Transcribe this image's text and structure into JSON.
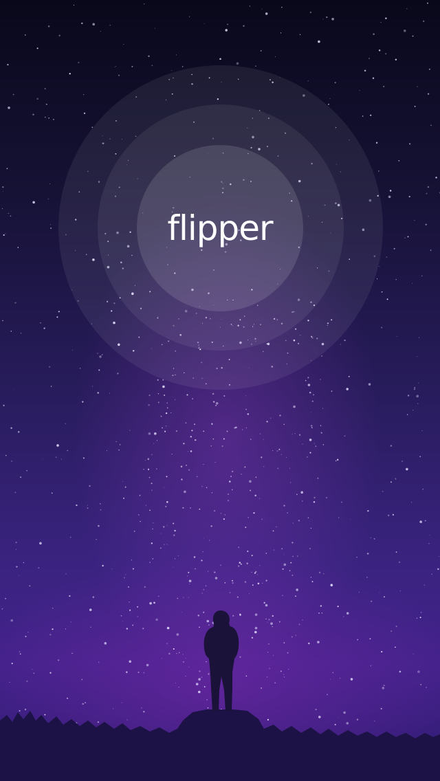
{
  "app": {
    "logo_text": "flipper"
  },
  "colors": {
    "sky_top": "#09081a",
    "sky_mid": "#281c5c",
    "sky_bottom": "#42228a",
    "milky_way_glow": "#963cc8",
    "ground": "#1c1245",
    "logo_text": "#ffffff"
  }
}
